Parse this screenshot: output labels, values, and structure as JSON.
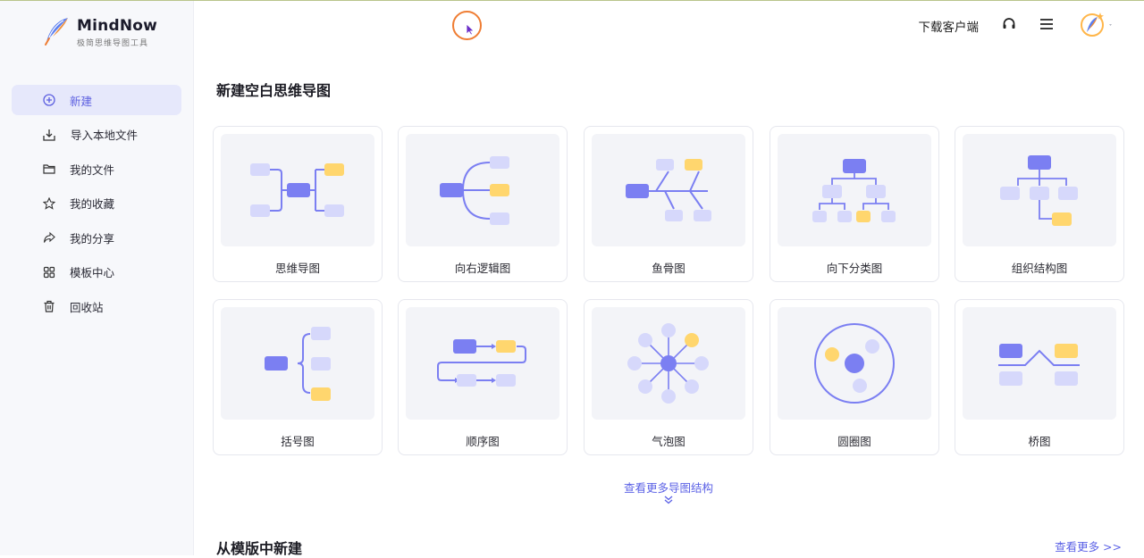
{
  "app": {
    "name": "MindNow",
    "tagline": "极简思维导图工具"
  },
  "sidebar": {
    "items": [
      {
        "label": "新建",
        "icon": "plus-circle-icon",
        "active": true
      },
      {
        "label": "导入本地文件",
        "icon": "import-icon"
      },
      {
        "label": "我的文件",
        "icon": "folder-icon"
      },
      {
        "label": "我的收藏",
        "icon": "star-icon"
      },
      {
        "label": "我的分享",
        "icon": "share-icon"
      },
      {
        "label": "模板中心",
        "icon": "template-grid-icon"
      },
      {
        "label": "回收站",
        "icon": "trash-icon"
      }
    ]
  },
  "header": {
    "download_label": "下载客户端",
    "icons": [
      "headset-icon",
      "menu-icon",
      "avatar"
    ]
  },
  "blank_section": {
    "title": "新建空白思维导图",
    "cards": [
      {
        "label": "思维导图",
        "icon": "mindmap-diagram-icon"
      },
      {
        "label": "向右逻辑图",
        "icon": "right-logic-diagram-icon"
      },
      {
        "label": "鱼骨图",
        "icon": "fishbone-diagram-icon"
      },
      {
        "label": "向下分类图",
        "icon": "down-tree-diagram-icon"
      },
      {
        "label": "组织结构图",
        "icon": "org-chart-icon"
      },
      {
        "label": "括号图",
        "icon": "bracket-diagram-icon"
      },
      {
        "label": "顺序图",
        "icon": "sequence-diagram-icon"
      },
      {
        "label": "气泡图",
        "icon": "bubble-diagram-icon"
      },
      {
        "label": "圆圈图",
        "icon": "circle-diagram-icon"
      },
      {
        "label": "桥图",
        "icon": "bridge-diagram-icon"
      }
    ],
    "view_more": "查看更多导图结构"
  },
  "template_section": {
    "title": "从模版中新建",
    "more_label": "查看更多 >>"
  },
  "colors": {
    "accent": "#5c62e6",
    "node_purple": "#7b7ff2",
    "node_light": "#d6d8fb",
    "node_yellow": "#ffd66e",
    "sidebar_bg": "#f7f8fb",
    "active_bg": "#e6e8fb"
  }
}
